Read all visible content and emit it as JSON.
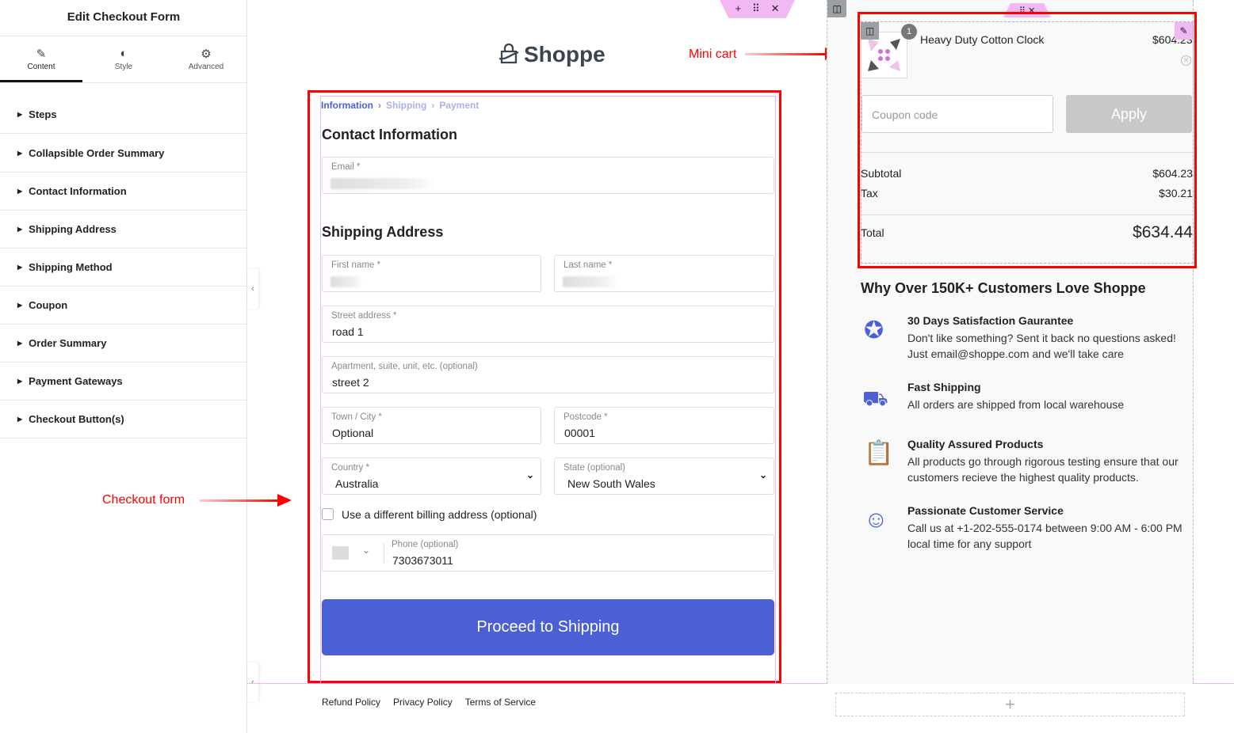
{
  "sidebar": {
    "title": "Edit Checkout Form",
    "tabs": [
      {
        "label": "Content",
        "icon": "pencil-icon"
      },
      {
        "label": "Style",
        "icon": "contrast-icon"
      },
      {
        "label": "Advanced",
        "icon": "gear-icon"
      }
    ],
    "items": [
      "Steps",
      "Collapsible Order Summary",
      "Contact Information",
      "Shipping Address",
      "Shipping Method",
      "Coupon",
      "Order Summary",
      "Payment Gateways",
      "Checkout Button(s)"
    ]
  },
  "brand": {
    "name": "Shoppe"
  },
  "annotations": {
    "mini_cart": "Mini cart",
    "checkout_form": "Checkout form",
    "color": "#ff0000"
  },
  "form": {
    "breadcrumb": [
      "Information",
      "Shipping",
      "Payment"
    ],
    "contact_heading": "Contact Information",
    "email_label": "Email *",
    "shipping_heading": "Shipping Address",
    "first_name_label": "First name *",
    "last_name_label": "Last name *",
    "street_label": "Street address *",
    "street_value": "road 1",
    "apt_label": "Apartment, suite, unit, etc. (optional)",
    "apt_value": "street 2",
    "town_label": "Town / City *",
    "town_value": "Optional",
    "postcode_label": "Postcode *",
    "postcode_value": "00001",
    "country_label": "Country *",
    "country_value": "Australia",
    "state_label": "State (optional)",
    "state_value": "New South Wales",
    "billing_checkbox": "Use a different billing address (optional)",
    "billing_checked": false,
    "phone_label": "Phone (optional)",
    "phone_value": "7303673011",
    "submit": "Proceed to Shipping",
    "accent": "#4a60d4"
  },
  "footer": {
    "links": [
      "Refund Policy",
      "Privacy Policy",
      "Terms of Service"
    ]
  },
  "cart": {
    "item_name": "Heavy Duty Cotton Clock",
    "item_price": "$604.23",
    "qty": "1",
    "coupon_placeholder": "Coupon code",
    "apply": "Apply",
    "subtotal_label": "Subtotal",
    "subtotal": "$604.23",
    "tax_label": "Tax",
    "tax": "$30.21",
    "total_label": "Total",
    "total": "$634.44"
  },
  "why": {
    "heading": "Why Over 150K+ Customers Love Shoppe",
    "features": [
      {
        "title": "30 Days Satisfaction Gaurantee",
        "desc": "Don't like something? Sent it back no questions asked! Just email@shoppe.com and we'll take care",
        "icon": "badge-check-icon"
      },
      {
        "title": "Fast Shipping",
        "desc": "All orders are shipped from local warehouse",
        "icon": "truck-icon"
      },
      {
        "title": "Quality Assured Products",
        "desc": "All products go through rigorous testing ensure that our customers recieve the highest quality products.",
        "icon": "clipboard-check-icon"
      },
      {
        "title": "Passionate Customer Service",
        "desc": "Call us at +1-202-555-0174 between 9:00 AM - 6:00 PM local time for any support",
        "icon": "support-agent-icon"
      }
    ]
  }
}
